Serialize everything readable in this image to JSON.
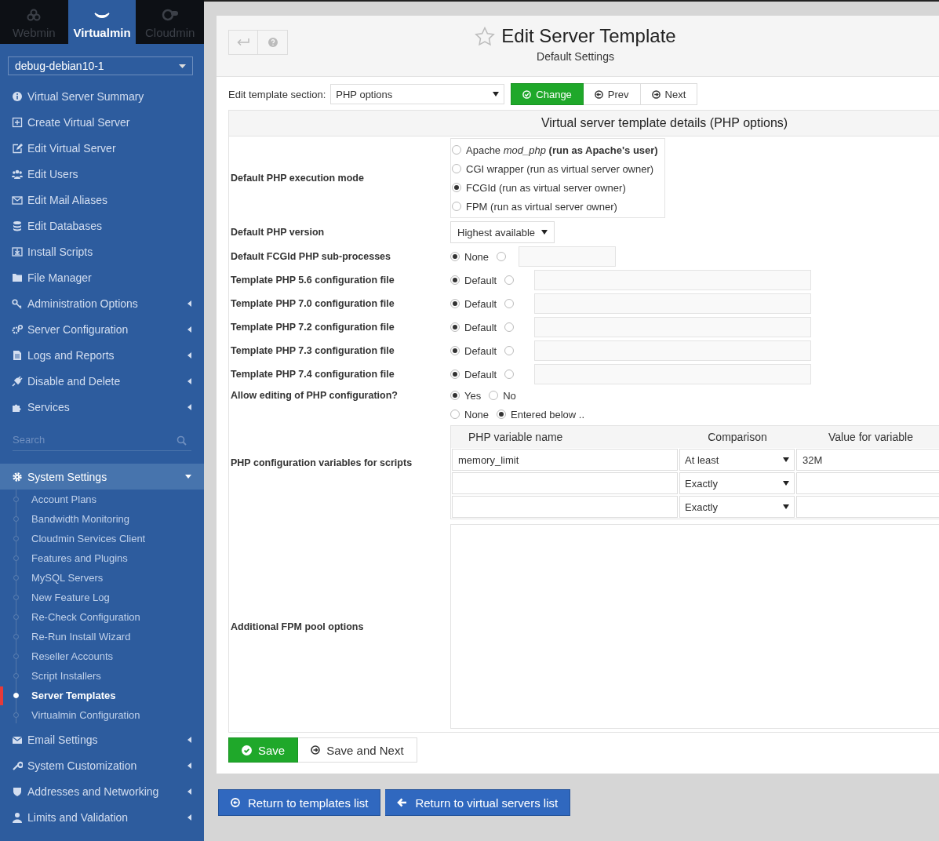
{
  "product_tabs": [
    {
      "label": "Webmin",
      "selected": false
    },
    {
      "label": "Virtualmin",
      "selected": true
    },
    {
      "label": "Cloudmin",
      "selected": false
    }
  ],
  "server_select": {
    "value": "debug-debian10-1"
  },
  "menu": [
    {
      "label": "Virtual Server Summary",
      "has_submenu": false
    },
    {
      "label": "Create Virtual Server",
      "has_submenu": false
    },
    {
      "label": "Edit Virtual Server",
      "has_submenu": false
    },
    {
      "label": "Edit Users",
      "has_submenu": false
    },
    {
      "label": "Edit Mail Aliases",
      "has_submenu": false
    },
    {
      "label": "Edit Databases",
      "has_submenu": false
    },
    {
      "label": "Install Scripts",
      "has_submenu": false
    },
    {
      "label": "File Manager",
      "has_submenu": false
    },
    {
      "label": "Administration Options",
      "has_submenu": true
    },
    {
      "label": "Server Configuration",
      "has_submenu": true
    },
    {
      "label": "Logs and Reports",
      "has_submenu": true
    },
    {
      "label": "Disable and Delete",
      "has_submenu": true
    },
    {
      "label": "Services",
      "has_submenu": true
    }
  ],
  "search": {
    "placeholder": "Search"
  },
  "settings_menu": [
    {
      "label": "System Settings",
      "expanded": true,
      "children": [
        {
          "label": "Account Plans",
          "selected": false
        },
        {
          "label": "Bandwidth Monitoring",
          "selected": false
        },
        {
          "label": "Cloudmin Services Client",
          "selected": false
        },
        {
          "label": "Features and Plugins",
          "selected": false
        },
        {
          "label": "MySQL Servers",
          "selected": false
        },
        {
          "label": "New Feature Log",
          "selected": false
        },
        {
          "label": "Re-Check Configuration",
          "selected": false
        },
        {
          "label": "Re-Run Install Wizard",
          "selected": false
        },
        {
          "label": "Reseller Accounts",
          "selected": false
        },
        {
          "label": "Script Installers",
          "selected": false
        },
        {
          "label": "Server Templates",
          "selected": true
        },
        {
          "label": "Virtualmin Configuration",
          "selected": false
        }
      ]
    },
    {
      "label": "Email Settings",
      "expanded": false
    },
    {
      "label": "System Customization",
      "expanded": false
    },
    {
      "label": "Addresses and Networking",
      "expanded": false
    },
    {
      "label": "Limits and Validation",
      "expanded": false
    }
  ],
  "page": {
    "title": "Edit Server Template",
    "subtitle": "Default Settings"
  },
  "section_picker": {
    "label": "Edit template section:",
    "value": "PHP options",
    "buttons": [
      {
        "label": "Change",
        "kind": "primary"
      },
      {
        "label": "Prev",
        "kind": "prev"
      },
      {
        "label": "Next",
        "kind": "next"
      }
    ]
  },
  "form": {
    "heading": "Virtual server template details (PHP options)",
    "rows": [
      {
        "label": "Default PHP execution mode",
        "kind": "radio_list",
        "options": [
          {
            "label": "Apache *mod_php* **(run as Apache's user)**",
            "selected": false
          },
          {
            "label": "CGI wrapper (run as virtual server owner)",
            "selected": false
          },
          {
            "label": "FCGId (run as virtual server owner)",
            "selected": true
          },
          {
            "label": "FPM (run as virtual server owner)",
            "selected": false
          }
        ]
      },
      {
        "label": "Default PHP version",
        "kind": "select",
        "value": "Highest available"
      },
      {
        "label": "Default FCGId PHP sub-processes",
        "kind": "radio_number",
        "default_label": "None",
        "default_selected": true
      },
      {
        "label": "Template PHP 5.6 configuration file",
        "kind": "radio_file",
        "default_label": "Default",
        "default_selected": true
      },
      {
        "label": "Template PHP 7.0 configuration file",
        "kind": "radio_file",
        "default_label": "Default",
        "default_selected": true
      },
      {
        "label": "Template PHP 7.2 configuration file",
        "kind": "radio_file",
        "default_label": "Default",
        "default_selected": true
      },
      {
        "label": "Template PHP 7.3 configuration file",
        "kind": "radio_file",
        "default_label": "Default",
        "default_selected": true
      },
      {
        "label": "Template PHP 7.4 configuration file",
        "kind": "radio_file",
        "default_label": "Default",
        "default_selected": true
      },
      {
        "label": "Allow editing of PHP configuration?",
        "kind": "radio_inline",
        "options": [
          {
            "label": "Yes",
            "selected": true
          },
          {
            "label": "No",
            "selected": false
          }
        ]
      },
      {
        "label": "PHP configuration variables for scripts",
        "kind": "var_table",
        "options": [
          {
            "label": "None",
            "selected": false
          },
          {
            "label": "Entered below ..",
            "selected": true
          }
        ],
        "columns": [
          "PHP variable name",
          "Comparison",
          "Value for variable"
        ],
        "rows": [
          {
            "name": "memory_limit",
            "comparison": "At least",
            "value": "32M"
          },
          {
            "comparison": "Exactly"
          },
          {
            "comparison": "Exactly"
          }
        ]
      },
      {
        "label": "Additional FPM pool options",
        "kind": "textarea"
      }
    ]
  },
  "form_buttons": [
    {
      "label": "Save",
      "kind": "primary"
    },
    {
      "label": "Save and Next",
      "kind": "next"
    }
  ],
  "footer_buttons": [
    {
      "label": "Return to templates list",
      "kind": "back_circle"
    },
    {
      "label": "Return to virtual servers list",
      "kind": "back_arrow"
    }
  ]
}
